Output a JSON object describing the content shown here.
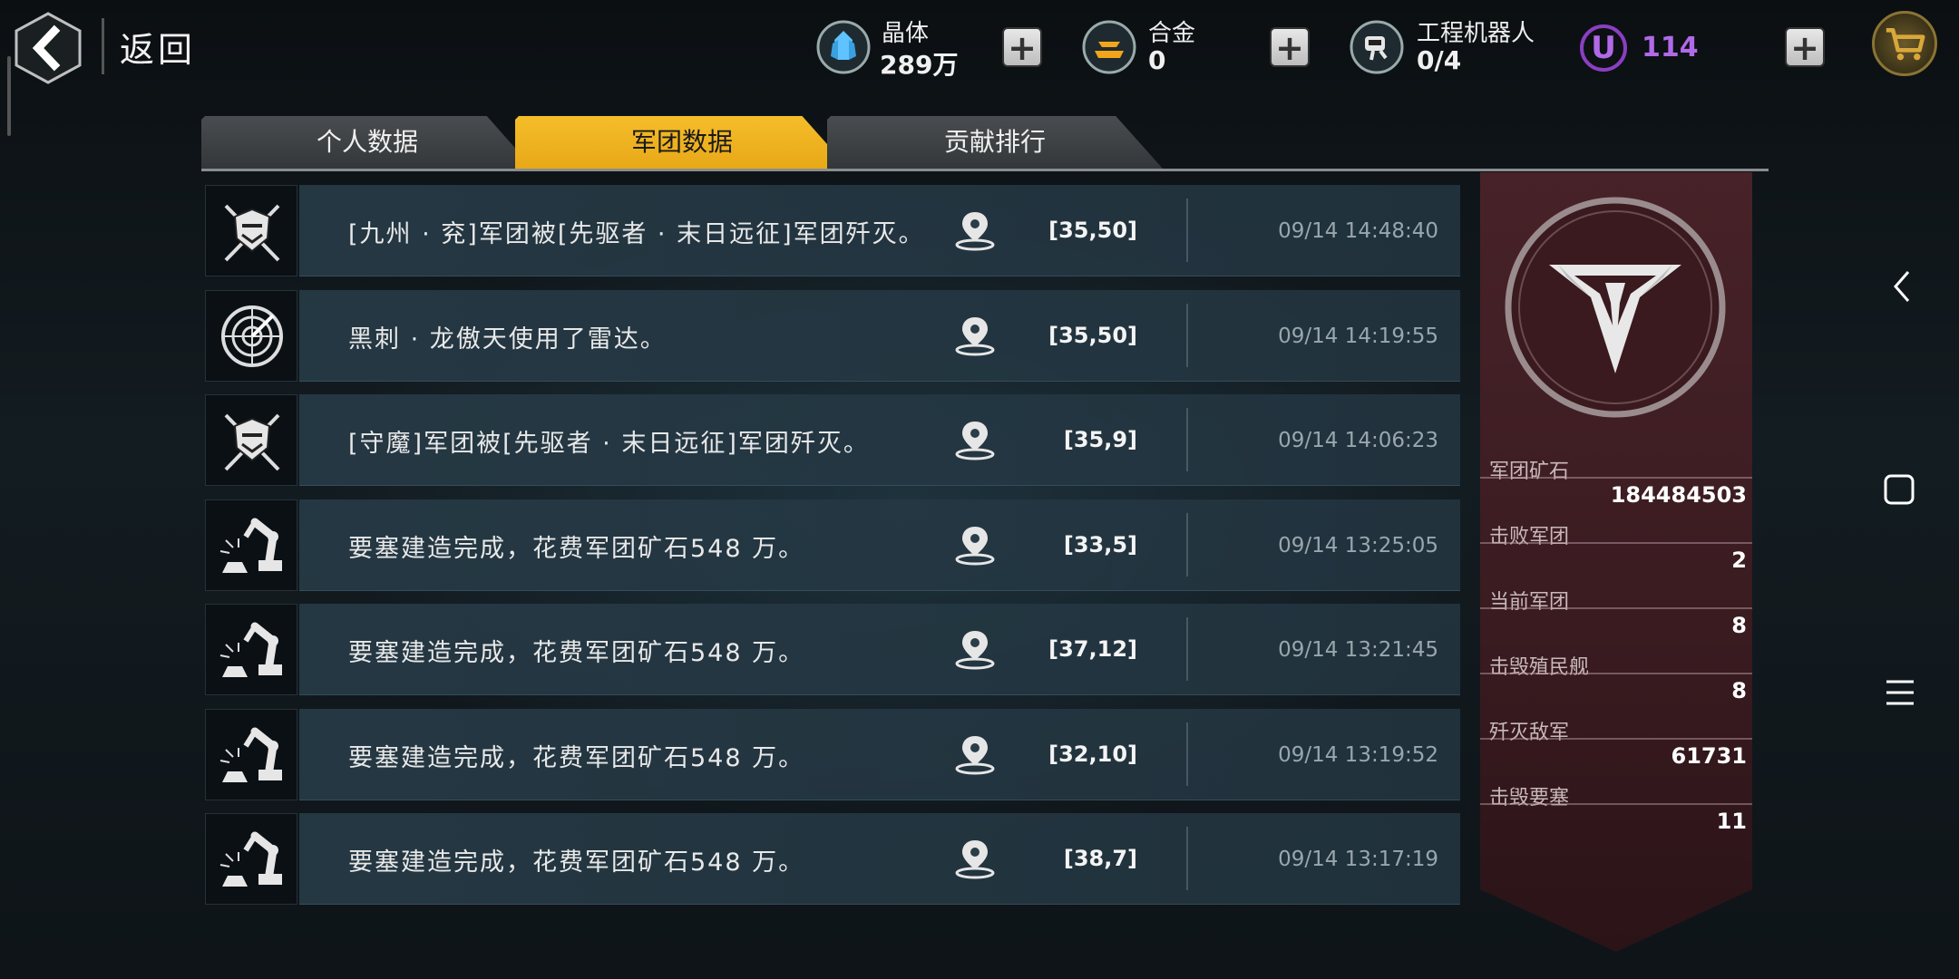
{
  "topbar": {
    "back_label": "返回",
    "crystal": {
      "title": "晶体",
      "value": "289万"
    },
    "alloy": {
      "title": "合金",
      "value": "0"
    },
    "robot": {
      "title": "工程机器人",
      "value": "0/4"
    },
    "u_currency": {
      "icon": "U",
      "value": "114"
    },
    "plus": "+"
  },
  "tabs": [
    {
      "label": "个人数据",
      "active": false
    },
    {
      "label": "军团数据",
      "active": true
    },
    {
      "label": "贡献排行",
      "active": false
    }
  ],
  "log": [
    {
      "icon": "crossed-swords-shield-icon",
      "text": "[九州 · 兖]军团被[先驱者 · 末日远征]军团歼灭。",
      "coord": "[35,50]",
      "time": "09/14 14:48:40"
    },
    {
      "icon": "radar-icon",
      "text": "黑刺 · 龙傲天使用了雷达。",
      "coord": "[35,50]",
      "time": "09/14 14:19:55"
    },
    {
      "icon": "crossed-swords-shield-icon",
      "text": "[守魔]军团被[先驱者 · 末日远征]军团歼灭。",
      "coord": "[35,9]",
      "time": "09/14 14:06:23"
    },
    {
      "icon": "robot-arm-icon",
      "text": "要塞建造完成，花费军团矿石548 万。",
      "coord": "[33,5]",
      "time": "09/14 13:25:05"
    },
    {
      "icon": "robot-arm-icon",
      "text": "要塞建造完成，花费军团矿石548 万。",
      "coord": "[37,12]",
      "time": "09/14 13:21:45"
    },
    {
      "icon": "robot-arm-icon",
      "text": "要塞建造完成，花费军团矿石548 万。",
      "coord": "[32,10]",
      "time": "09/14 13:19:52"
    },
    {
      "icon": "robot-arm-icon",
      "text": "要塞建造完成，花费军团矿石548 万。",
      "coord": "[38,7]",
      "time": "09/14 13:17:19"
    }
  ],
  "stats": [
    {
      "label": "军团矿石",
      "value": "184484503"
    },
    {
      "label": "击败军团",
      "value": "2"
    },
    {
      "label": "当前军团",
      "value": "8"
    },
    {
      "label": "击毁殖民舰",
      "value": "8"
    },
    {
      "label": "歼灭敌军",
      "value": "61731"
    },
    {
      "label": "击毁要塞",
      "value": "11"
    }
  ],
  "colors": {
    "accent": "#f5bd2a",
    "stats_panel": "#4a2329",
    "u_currency": "#b06ae8"
  }
}
